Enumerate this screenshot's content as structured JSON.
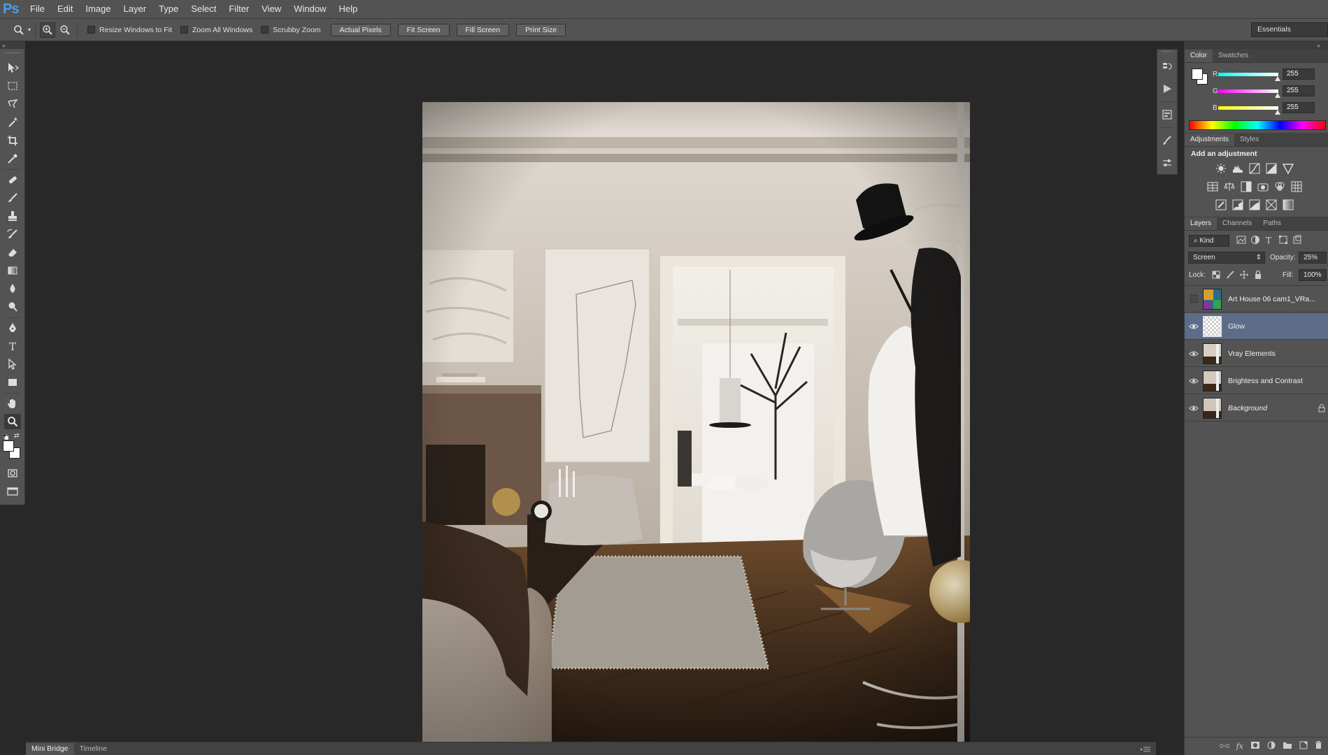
{
  "app": {
    "logo": "Ps"
  },
  "menu": [
    "File",
    "Edit",
    "Image",
    "Layer",
    "Type",
    "Select",
    "Filter",
    "View",
    "Window",
    "Help"
  ],
  "options": {
    "resize_windows": "Resize Windows to Fit",
    "zoom_all": "Zoom All Windows",
    "scrubby": "Scrubby Zoom",
    "actual_pixels": "Actual Pixels",
    "fit_screen": "Fit Screen",
    "fill_screen": "Fill Screen",
    "print_size": "Print Size",
    "workspace": "Essentials"
  },
  "color_panel": {
    "tabs": [
      "Color",
      "Swatches"
    ],
    "r_label": "R",
    "g_label": "G",
    "b_label": "B",
    "r": "255",
    "g": "255",
    "b": "255"
  },
  "adjustments_panel": {
    "tabs": [
      "Adjustments",
      "Styles"
    ],
    "heading": "Add an adjustment"
  },
  "layers_panel": {
    "tabs": [
      "Layers",
      "Channels",
      "Paths"
    ],
    "filter_kind": "Kind",
    "blend_mode": "Screen",
    "opacity_label": "Opacity:",
    "opacity": "25%",
    "lock_label": "Lock:",
    "fill_label": "Fill:",
    "fill": "100%",
    "layers": [
      {
        "name": "Art House 06 cam1_VRa...",
        "visible": false,
        "selected": false,
        "italic": false
      },
      {
        "name": "Glow",
        "visible": true,
        "selected": true,
        "italic": false
      },
      {
        "name": "Vray Elements",
        "visible": true,
        "selected": false,
        "italic": false
      },
      {
        "name": "Brightess and Contrast",
        "visible": true,
        "selected": false,
        "italic": false
      },
      {
        "name": "Background",
        "visible": true,
        "selected": false,
        "italic": true,
        "locked": true
      }
    ]
  },
  "bottom_tabs": [
    "Mini Bridge",
    "Timeline"
  ]
}
